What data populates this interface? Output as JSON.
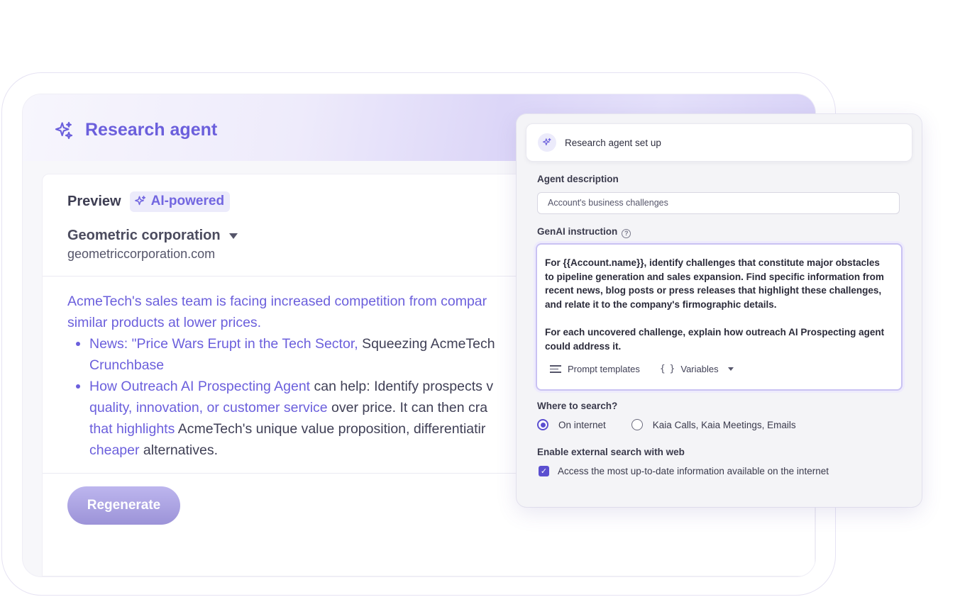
{
  "header": {
    "title": "Research agent"
  },
  "preview": {
    "label": "Preview",
    "badge": "AI-powered",
    "company_name": "Geometric corporation",
    "company_url": "geometriccorporation.com",
    "paragraph": {
      "hl": "AcmeTech's sales team is facing increased competition from compar",
      "line2_hl": "similar products at lower prices."
    },
    "bullets": [
      {
        "line1_hl": "News: \"Price Wars Erupt in the Tech Sector, ",
        "line1_rest": "Squeezing AcmeTech",
        "line2_hl": "Crunchbase"
      },
      {
        "line1_hl": "How Outreach AI Prospecting Agent ",
        "line1_rest": "can help: Identify prospects v",
        "line2_hl": "quality, innovation, or customer service ",
        "line2_rest": "over price. It can then cra",
        "line3_hl": "that highlights ",
        "line3_rest": "AcmeTech's unique value proposition, differentiatir",
        "line4_hl": "cheaper ",
        "line4_rest": "alternatives."
      }
    ],
    "regenerate_label": "Regenerate"
  },
  "setup": {
    "title": "Research agent set up",
    "agent_description_label": "Agent description",
    "agent_description_value": "Account's business challenges",
    "genai_label": "GenAI instruction",
    "help_glyph": "?",
    "instruction_lines": [
      "For {{Account.name}}, identify challenges that constitute major obstacles",
      "to pipeline generation and sales expansion. Find specific information from",
      "recent news, blog posts or press releases that highlight these challenges,",
      "and relate it to the company's firmographic details."
    ],
    "instruction_lines_2": [
      "For each uncovered challenge, explain how outreach AI Prospecting agent",
      "could address it."
    ],
    "prompt_templates_label": "Prompt templates",
    "variables_label": "Variables",
    "braces_glyph": "{ }",
    "where_label": "Where to search?",
    "radio_options": [
      "On internet",
      "Kaia Calls, Kaia Meetings, Emails"
    ],
    "selected_radio": "On internet",
    "external_label": "Enable external search with web",
    "external_checkbox_label": "Access the most up-to-date information available on the internet",
    "external_checked": true,
    "check_glyph": "✓"
  },
  "colors": {
    "accent": "#6b5fdc",
    "radio_accent": "#5b4fd0",
    "button": "#a9a1e0"
  }
}
